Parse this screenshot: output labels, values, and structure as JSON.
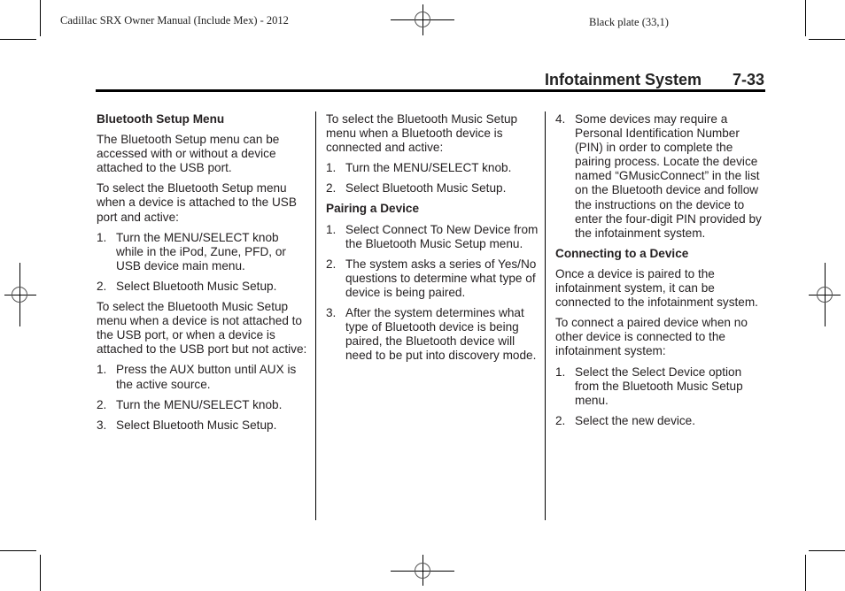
{
  "print_header": {
    "left": "Cadillac SRX Owner Manual (Include Mex) - 2012",
    "right": "Black plate (33,1)"
  },
  "running_header": {
    "section": "Infotainment System",
    "page_number": "7-33"
  },
  "columns": [
    {
      "blocks": [
        {
          "type": "heading",
          "text": "Bluetooth Setup Menu"
        },
        {
          "type": "paragraph",
          "text": "The Bluetooth Setup menu can be accessed with or without a device attached to the USB port."
        },
        {
          "type": "paragraph",
          "text": "To select the Bluetooth Setup menu when a device is attached to the USB port and active:"
        },
        {
          "type": "list",
          "items": [
            {
              "num": "1.",
              "text": "Turn the MENU/SELECT knob while in the iPod, Zune, PFD, or USB device main menu."
            },
            {
              "num": "2.",
              "text": "Select Bluetooth Music Setup."
            }
          ]
        },
        {
          "type": "paragraph",
          "text": "To select the Bluetooth Music Setup menu when a device is not attached to the USB port, or when a device is attached to the USB port but not active:"
        },
        {
          "type": "list",
          "items": [
            {
              "num": "1.",
              "text": "Press the AUX button until AUX is the active source."
            },
            {
              "num": "2.",
              "text": "Turn the MENU/SELECT knob."
            },
            {
              "num": "3.",
              "text": "Select Bluetooth Music Setup."
            }
          ]
        }
      ]
    },
    {
      "blocks": [
        {
          "type": "paragraph",
          "text": "To select the Bluetooth Music Setup menu when a Bluetooth device is connected and active:"
        },
        {
          "type": "list",
          "items": [
            {
              "num": "1.",
              "text": "Turn the MENU/SELECT knob."
            },
            {
              "num": "2.",
              "text": "Select Bluetooth Music Setup."
            }
          ]
        },
        {
          "type": "heading",
          "text": "Pairing a Device"
        },
        {
          "type": "list",
          "items": [
            {
              "num": "1.",
              "text": "Select Connect To New Device from the Bluetooth Music Setup menu."
            },
            {
              "num": "2.",
              "text": "The system asks a series of Yes/No questions to determine what type of device is being paired."
            },
            {
              "num": "3.",
              "text": "After the system determines what type of Bluetooth device is being paired, the Bluetooth device will need to be put into discovery mode."
            }
          ]
        }
      ]
    },
    {
      "blocks": [
        {
          "type": "list",
          "items": [
            {
              "num": "4.",
              "text": "Some devices may require a Personal Identification Number (PIN) in order to complete the pairing process. Locate the device named “GMusicConnect” in the list on the Bluetooth device and follow the instructions on the device to enter the four-digit PIN provided by the infotainment system."
            }
          ]
        },
        {
          "type": "heading",
          "text": "Connecting to a Device"
        },
        {
          "type": "paragraph",
          "text": "Once a device is paired to the infotainment system, it can be connected to the infotainment system."
        },
        {
          "type": "paragraph",
          "text": "To connect a paired device when no other device is connected to the infotainment system:"
        },
        {
          "type": "list",
          "items": [
            {
              "num": "1.",
              "text": "Select the Select Device option from the Bluetooth Music Setup menu."
            },
            {
              "num": "2.",
              "text": "Select the new device."
            }
          ]
        }
      ]
    }
  ]
}
